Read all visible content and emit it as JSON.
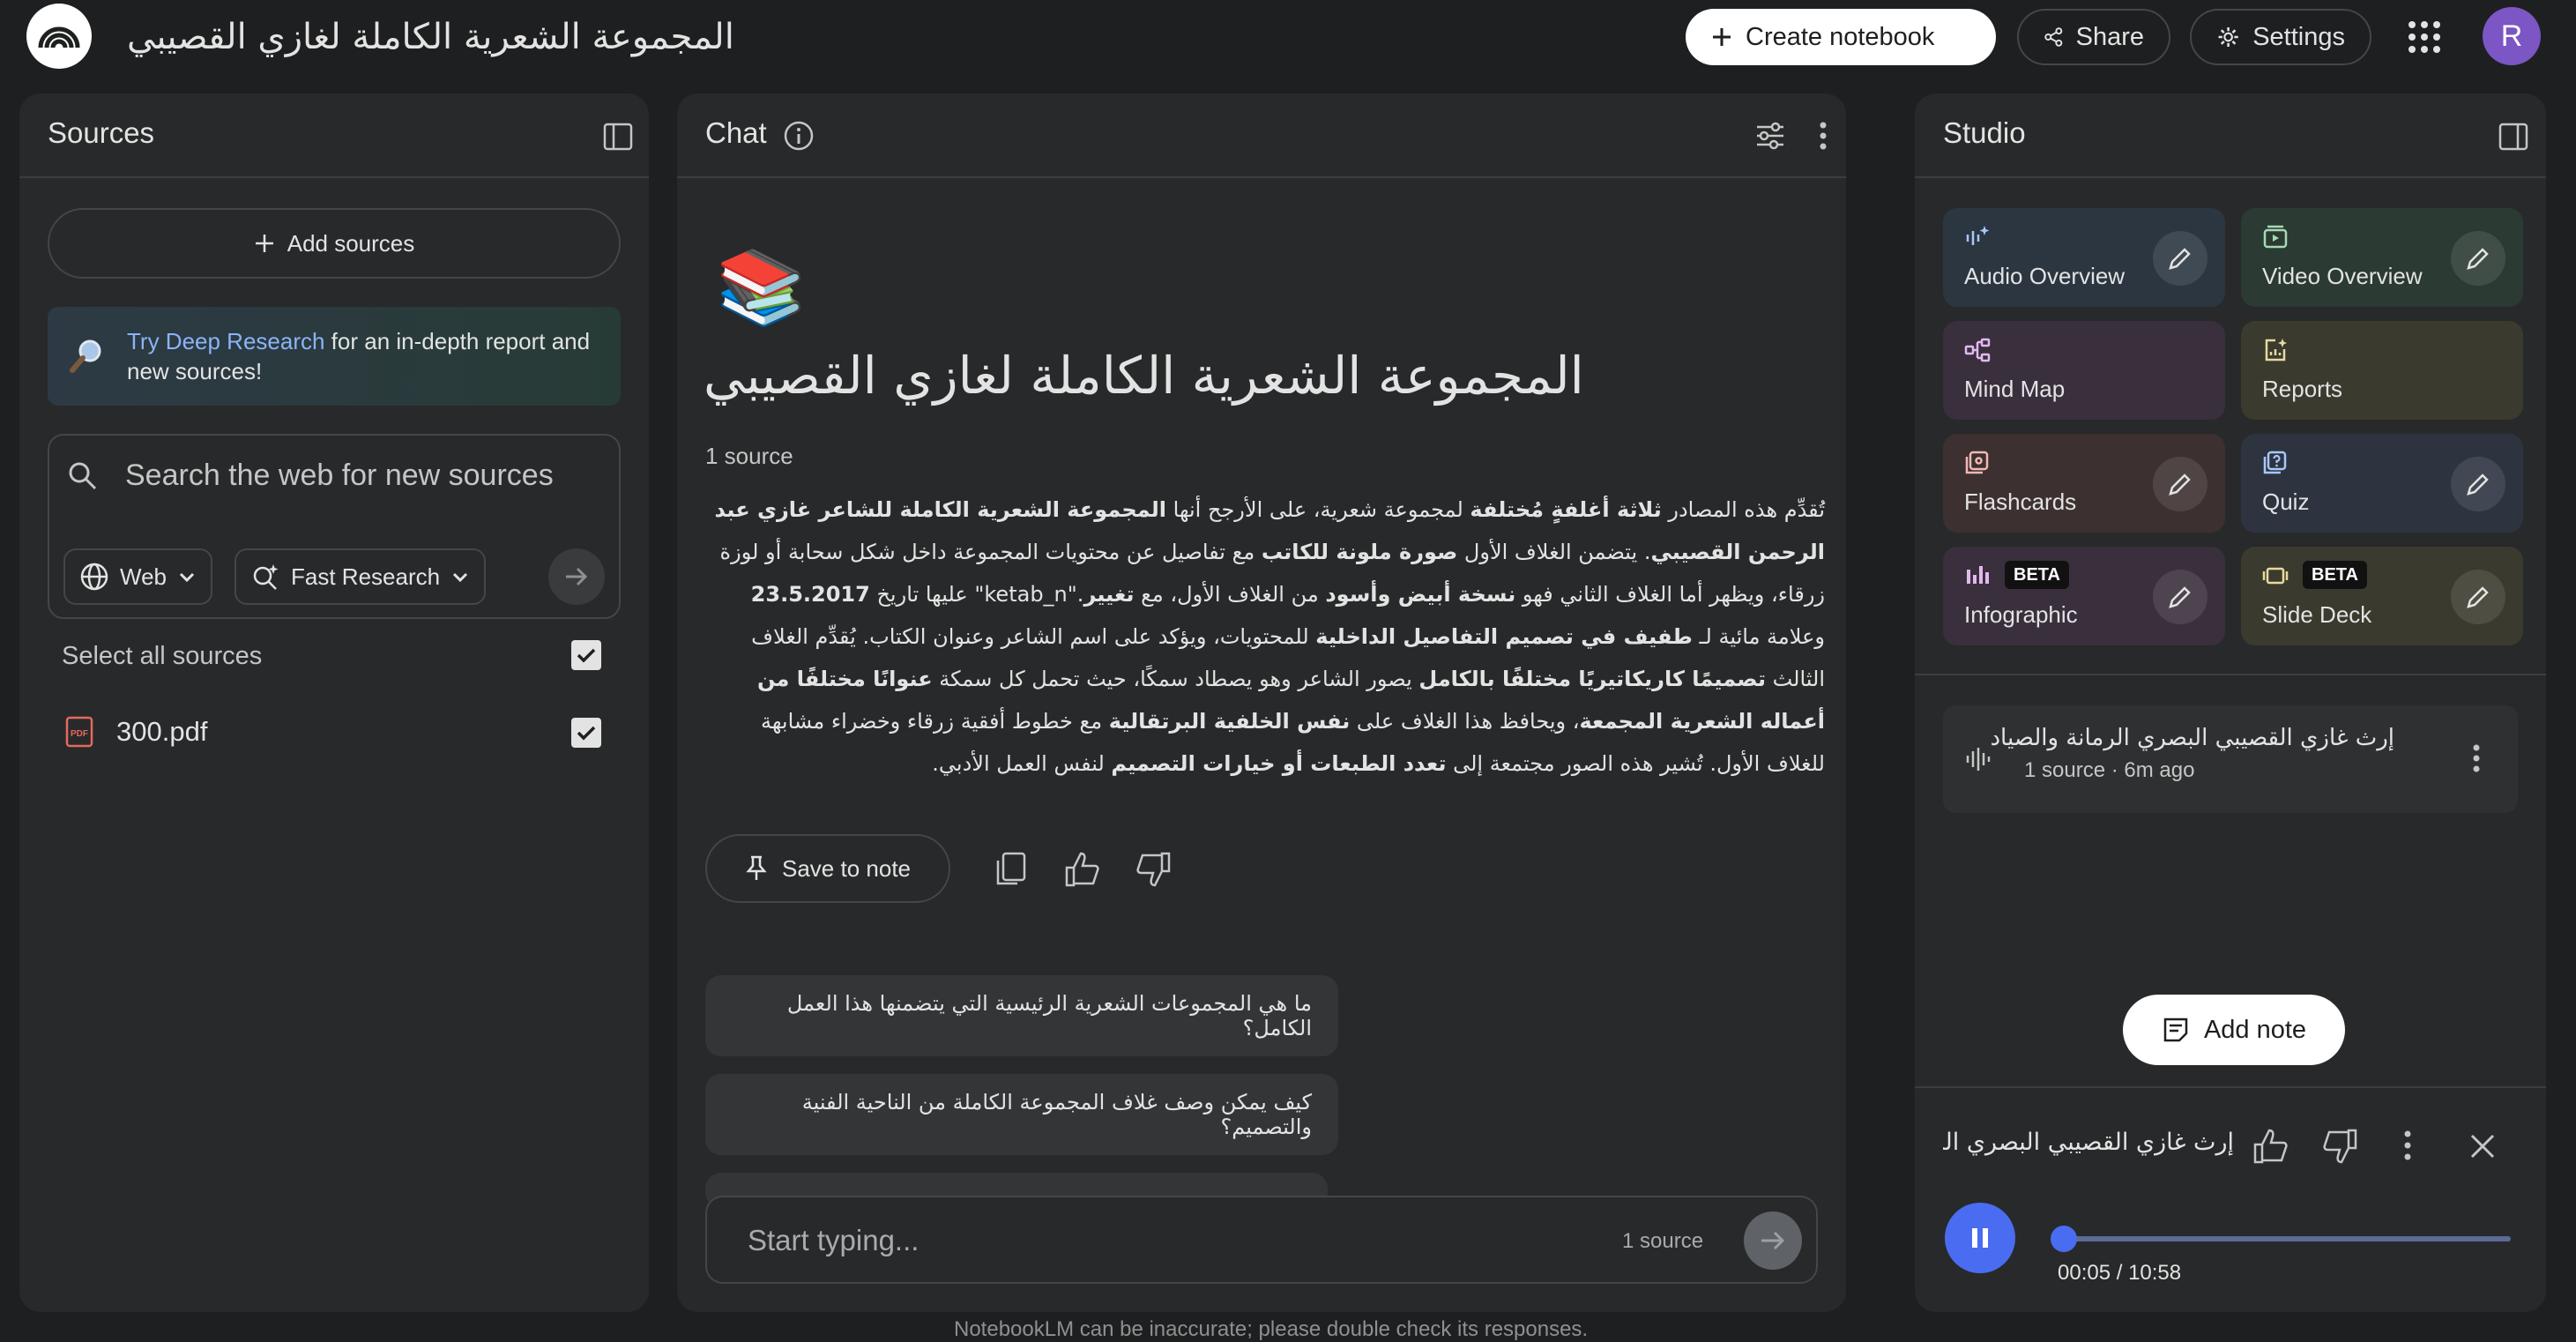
{
  "header": {
    "notebook_title": "المجموعة الشعرية الكاملة لغازي القصيبي",
    "create_label": "Create notebook",
    "share_label": "Share",
    "settings_label": "Settings",
    "avatar_letter": "R"
  },
  "sources": {
    "title": "Sources",
    "add_label": "Add sources",
    "deep_research_link": "Try Deep Research",
    "deep_research_rest": " for an in-depth report and new sources!",
    "search_placeholder": "Search the web for new sources",
    "chip_web": "Web",
    "chip_research": "Fast Research",
    "select_all": "Select all sources",
    "items": [
      {
        "name": "300.pdf",
        "type_badge": "PDF"
      }
    ]
  },
  "chat": {
    "title": "Chat",
    "heading": "المجموعة الشعرية الكاملة لغازي القصيبي",
    "source_count": "1 source",
    "summary": {
      "s1a": "تُقدِّم هذه المصادر ",
      "s1b": "ثلاثة أغلفةٍ مُختلفة",
      "s1c": " لمجموعة شعرية، على الأرجح أنها ",
      "s1d": "المجموعة الشعرية الكاملة للشاعر غازي عبد الرحمن القصيبي",
      "s1e": ". يتضمن الغلاف الأول ",
      "s1f": "صورة ملونة للكاتب",
      "s1g": " مع تفاصيل عن محتويات المجموعة داخل شكل سحابة أو لوزة زرقاء، ويظهر أما الغلاف الثاني فهو ",
      "s1h": "نسخة أبيض وأسود",
      "s1i": " من الغلاف الأول، مع ",
      "s1j": "تغيير",
      "s1k": " طفيف في ",
      "s1l": "تصميم التفاصيل الداخلية",
      "s1m": " للمحتويات، ويؤكد على اسم الشاعر وعنوان الكتاب. يُقدِّم الغلاف الثالث ",
      "s1n": "تصميمًا كاريكاتيريًا مختلفًا بالكامل",
      "s1o": " يصور الشاعر وهو يصطاد سمكًا، حيث تحمل كل سمكة ",
      "s1p": "عنوانًا مختلفًا من أعماله الشعرية المجمعة",
      "s1q": "، ويحافظ هذا الغلاف على ",
      "s1r": "نفس الخلفية البرتقالية",
      "s1s": " مع خطوط أفقية زرقاء وخضراء مشابهة للغلاف الأول. تُشير هذه الصور مجتمعة إلى ",
      "s1t": "تعدد الطبعات أو خيارات التصميم",
      "s1u": " لنفس العمل الأدبي.",
      "date": "23.5.2017",
      "date_pre": " عليها تاريخ ",
      "ketab": ".\"ketab_n\"",
      "watermark": "وعلامة مائية لـ "
    },
    "save_note_label": "Save to note",
    "suggestions": [
      "ما هي المجموعات الشعرية الرئيسية التي يتضمنها هذا العمل الكامل؟",
      "كيف يمكن وصف غلاف المجموعة الكاملة من الناحية الفنية والتصميم؟"
    ],
    "input_placeholder": "Start typing...",
    "input_source_count": "1 source",
    "disclaimer": "NotebookLM can be inaccurate; please double check its responses."
  },
  "studio": {
    "title": "Studio",
    "tiles": [
      {
        "label": "Audio Overview",
        "color": "#2b3640"
      },
      {
        "label": "Video Overview",
        "color": "#2b3a33"
      },
      {
        "label": "Mind Map",
        "color": "#3a2f3d"
      },
      {
        "label": "Reports",
        "color": "#3a3a2e"
      },
      {
        "label": "Flashcards",
        "color": "#3d3030"
      },
      {
        "label": "Quiz",
        "color": "#2d3440"
      },
      {
        "label": "Infographic",
        "color": "#3a2f3d",
        "badge": "BETA"
      },
      {
        "label": "Slide Deck",
        "color": "#3a3a2e",
        "badge": "BETA"
      }
    ],
    "audio_item": {
      "title": "إرث غازي القصيبي البصري الرمانة والصياد",
      "meta": "1 source · 6m ago"
    },
    "add_note_label": "Add note",
    "player": {
      "title": "إرث غازي القصيبي البصري الرمانة والصياد",
      "time": "00:05 / 10:58",
      "progress_fraction": 0.008
    }
  }
}
